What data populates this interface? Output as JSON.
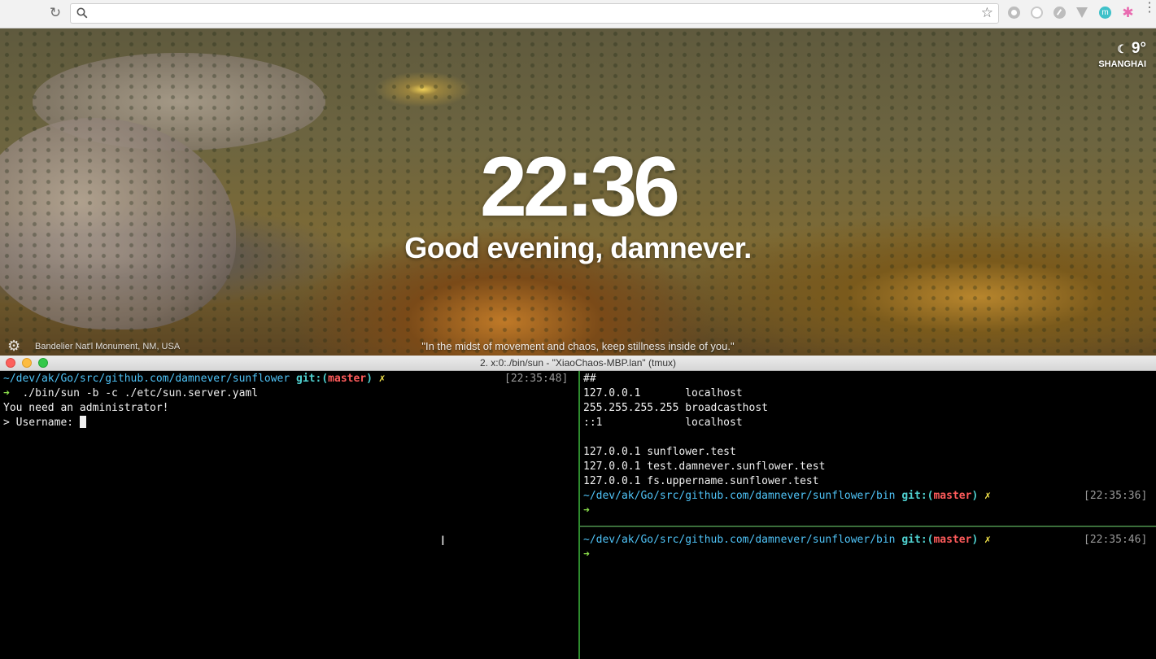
{
  "browser": {
    "address_value": "",
    "address_placeholder": "",
    "extensions": [
      "record-extension-icon",
      "circle-extension-icon",
      "speed-extension-icon",
      "vpn-extension-icon",
      "m-extension-icon",
      "pinwheel-extension-icon"
    ],
    "accent": "#4a90e2"
  },
  "newtab": {
    "time": "22:36",
    "greeting": "Good evening, damnever.",
    "weather_temp": "9°",
    "weather_city": "SHANGHAI",
    "photo_location": "Bandelier Nat'l Monument, NM, USA",
    "quote": "\"In the midst of movement and chaos, keep stillness inside of you.\""
  },
  "terminal": {
    "title": "2. x:0:./bin/sun - \"XiaoChaos-MBP.lan\"  (tmux)",
    "left_pane": {
      "prompt_path": "~/dev/ak/Go/src/github.com/damnever/sunflower",
      "git_label": "git:(",
      "branch": "master",
      "git_close": ")",
      "dirty_mark": "✗",
      "timestamp": "[22:35:48]",
      "arrow": "➜",
      "command": "  ./bin/sun -b -c ./etc/sun.server.yaml",
      "output_1": "You need an administrator!",
      "output_2": "> Username: "
    },
    "right_top_pane": {
      "lines": [
        "##",
        "127.0.0.1       localhost",
        "255.255.255.255 broadcasthost",
        "::1             localhost",
        "",
        "127.0.0.1 sunflower.test",
        "127.0.0.1 test.damnever.sunflower.test",
        "127.0.0.1 fs.uppername.sunflower.test"
      ],
      "prompt_path": "~/dev/ak/Go/src/github.com/damnever/sunflower/bin",
      "git_label": "git:(",
      "branch": "master",
      "git_close": ")",
      "dirty_mark": "✗",
      "timestamp": "[22:35:36]",
      "arrow": "➜"
    },
    "right_bottom_pane": {
      "prompt_path": "~/dev/ak/Go/src/github.com/damnever/sunflower/bin",
      "git_label": "git:(",
      "branch": "master",
      "git_close": ")",
      "dirty_mark": "✗",
      "timestamp": "[22:35:46]",
      "arrow": "➜"
    },
    "colors": {
      "path": "#4fc3f7",
      "branch": "#ff5b5b",
      "arrow": "#8be04b",
      "dirty": "#f5e54a",
      "split": "#2e8b2e"
    }
  }
}
